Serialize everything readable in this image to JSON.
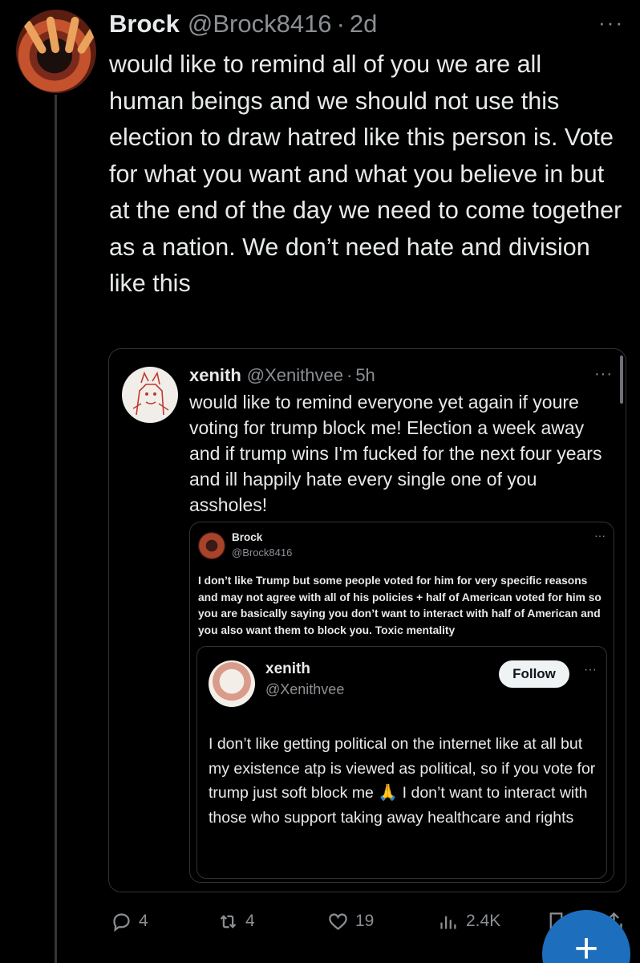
{
  "main_tweet": {
    "author_name": "Brock",
    "author_handle": "@Brock8416",
    "separator": "·",
    "time": "2d",
    "more": "···",
    "text": "would like to remind all of you we are all human beings and we should not use this election to draw hatred like this person is. Vote for what you want and what you believe in but at the end of the day we need to come together as a nation. We don’t need hate and division like this"
  },
  "quote1": {
    "author_name": "xenith",
    "author_handle": "@Xenithvee",
    "separator": "·",
    "time": "5h",
    "more": "···",
    "text": "would like to remind everyone yet again if youre voting for trump block me! Election a week away and if trump wins I'm fucked for the next four years and ill happily hate every single one of you assholes!"
  },
  "quote2": {
    "author_name": "Brock",
    "author_handle": "@Brock8416",
    "more": "···",
    "text": "I don’t like Trump but some people voted for him for very specific reasons and may not agree with all of his policies + half of American voted for him so you are basically saying you don’t want to interact with half of American and you also want them to block you. Toxic mentality"
  },
  "quote3": {
    "author_name": "xenith",
    "author_handle": "@Xenithvee",
    "follow_label": "Follow",
    "more": "···",
    "text_before_emoji": "I don’t like getting political on the internet like at all but my existence atp is viewed as political, so if you vote for trump just soft block me ",
    "emoji": "🙏",
    "text_after_emoji": " I don’t want to interact with those who support taking away healthcare and rights"
  },
  "actions": {
    "replies": "4",
    "reposts": "4",
    "likes": "19",
    "views": "2.4K"
  },
  "fab_label": "+",
  "colors": {
    "background": "#000000",
    "text": "#e7e9ea",
    "muted": "#8b8f94",
    "border": "#2f3336",
    "fab": "#1d6fbd"
  }
}
